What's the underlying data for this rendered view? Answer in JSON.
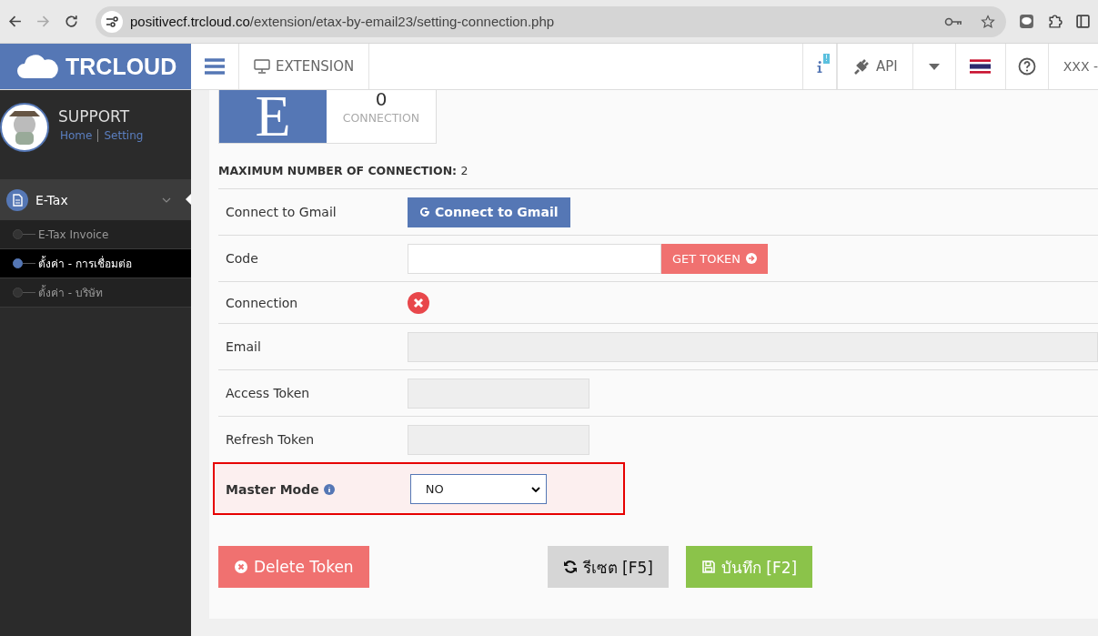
{
  "browser": {
    "url_host": "positivecf.trcloud.co",
    "url_path": "/extension/etax-by-email23/setting-connection.php"
  },
  "header": {
    "logo": "TRCLOUD",
    "module": "EXTENSION",
    "info_badge": "!",
    "api": "API",
    "user": "XXX -"
  },
  "sidebar": {
    "user": {
      "name": "SUPPORT",
      "links": [
        "Home",
        "Setting"
      ]
    },
    "menu": [
      {
        "label": "E-Tax",
        "expanded": true,
        "children": [
          {
            "label": "E-Tax Invoice",
            "selected": false
          },
          {
            "label": "ตั้งค่า - การเชื่อมต่อ",
            "selected": true
          },
          {
            "label": "ตั้งค่า - บริษัท",
            "selected": false
          }
        ]
      }
    ]
  },
  "summary": {
    "letter": "E",
    "count": "0",
    "caption": "CONNECTION"
  },
  "max_connection": {
    "label": "MAXIMUM NUMBER OF CONNECTION:",
    "value": "2"
  },
  "rows": [
    {
      "kind": "button",
      "label": "Connect to Gmail",
      "button": "Connect to Gmail"
    },
    {
      "kind": "token",
      "label": "Code",
      "button": "GET TOKEN"
    },
    {
      "kind": "status",
      "label": "Connection",
      "connected": false
    },
    {
      "kind": "wide",
      "label": "Email"
    },
    {
      "kind": "short",
      "label": "Access Token"
    },
    {
      "kind": "short",
      "label": "Refresh Token"
    },
    {
      "kind": "select",
      "label": "Master Mode",
      "value": "NO",
      "highlighted": true
    }
  ],
  "actions": {
    "delete": "Delete Token",
    "reset": "รีเซต [F5]",
    "save": "บันทึก [F2]"
  }
}
